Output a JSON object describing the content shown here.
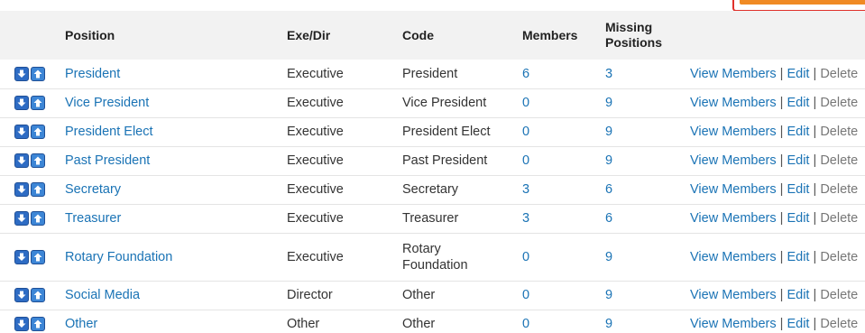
{
  "table": {
    "headers": {
      "position": "Position",
      "exe_dir": "Exe/Dir",
      "code": "Code",
      "members": "Members",
      "missing": "Missing Positions"
    },
    "rows": [
      {
        "position": "President",
        "exe_dir": "Executive",
        "code": "President",
        "members": "6",
        "missing": "3"
      },
      {
        "position": "Vice President",
        "exe_dir": "Executive",
        "code": "Vice President",
        "members": "0",
        "missing": "9"
      },
      {
        "position": "President Elect",
        "exe_dir": "Executive",
        "code": "President Elect",
        "members": "0",
        "missing": "9"
      },
      {
        "position": "Past President",
        "exe_dir": "Executive",
        "code": "Past President",
        "members": "0",
        "missing": "9"
      },
      {
        "position": "Secretary",
        "exe_dir": "Executive",
        "code": "Secretary",
        "members": "3",
        "missing": "6"
      },
      {
        "position": "Treasurer",
        "exe_dir": "Executive",
        "code": "Treasurer",
        "members": "3",
        "missing": "6"
      },
      {
        "position": "Rotary Foundation",
        "exe_dir": "Executive",
        "code": "Rotary Foundation",
        "members": "0",
        "missing": "9"
      },
      {
        "position": "Social Media",
        "exe_dir": "Director",
        "code": "Other",
        "members": "0",
        "missing": "9"
      },
      {
        "position": "Other",
        "exe_dir": "Other",
        "code": "Other",
        "members": "0",
        "missing": "9"
      }
    ],
    "actions": {
      "view_members": "View Members",
      "edit": "Edit",
      "delete": "Delete",
      "separator": "|"
    }
  },
  "icons": {
    "move_down": "arrow-down-icon",
    "move_up": "arrow-up-icon"
  },
  "colors": {
    "link": "#1a73b5",
    "arrow_button": "#2e6cc4",
    "header_bg": "#f2f2f2",
    "accent_button": "#f08a24",
    "accent_border": "#e0312b"
  }
}
